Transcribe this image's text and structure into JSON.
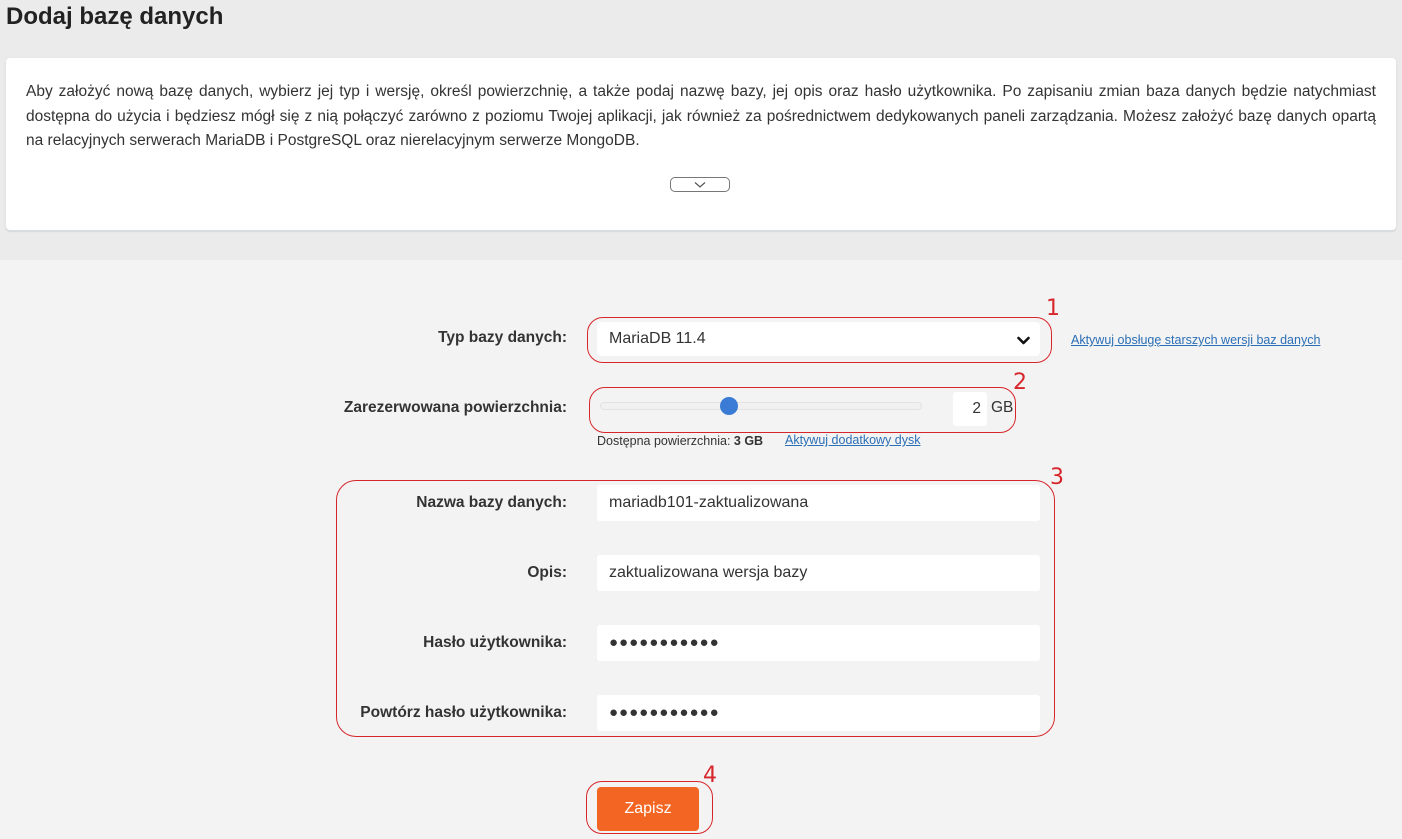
{
  "header": {
    "title": "Dodaj bazę danych"
  },
  "info": {
    "text": "Aby założyć nową bazę danych, wybierz jej typ i wersję, określ powierzchnię, a także podaj nazwę bazy, jej opis oraz hasło użytkownika. Po zapisaniu zmian baza danych będzie natychmiast dostępna do użycia i będziesz mógł się z nią połączyć zarówno z poziomu Twojej aplikacji, jak również za pośrednictwem dedykowanych paneli zarządzania. Możesz założyć bazę danych opartą na relacyjnych serwerach MariaDB i PostgreSQL oraz nierelacyjnym serwerze MongoDB.",
    "toggle_icon": "chevron-down-icon"
  },
  "form": {
    "db_type": {
      "label": "Typ bazy danych:",
      "value": "MariaDB 11.4",
      "legacy_link": "Aktywuj obsługę starszych wersji baz danych"
    },
    "storage": {
      "label": "Zarezerwowana powierzchnia:",
      "value": "2",
      "unit": "GB",
      "slider_fraction": 0.4,
      "available_label": "Dostępna powierzchnia:",
      "available_value": "3 GB",
      "extra_disk_link": "Aktywuj dodatkowy dysk"
    },
    "name": {
      "label": "Nazwa bazy danych:",
      "value": "mariadb101-zaktualizowana"
    },
    "description": {
      "label": "Opis:",
      "value": "zaktualizowana wersja bazy"
    },
    "password": {
      "label": "Hasło użytkownika:",
      "value": "●●●●●●●●●●●"
    },
    "password_repeat": {
      "label": "Powtórz hasło użytkownika:",
      "value": "●●●●●●●●●●●"
    },
    "save_label": "Zapisz"
  },
  "annotations": {
    "color": "#d7262b",
    "labels": [
      "1",
      "2",
      "3",
      "4"
    ]
  },
  "colors": {
    "accent": "#f26522",
    "slider": "#3a7bd5",
    "link": "#2b6fb6"
  }
}
